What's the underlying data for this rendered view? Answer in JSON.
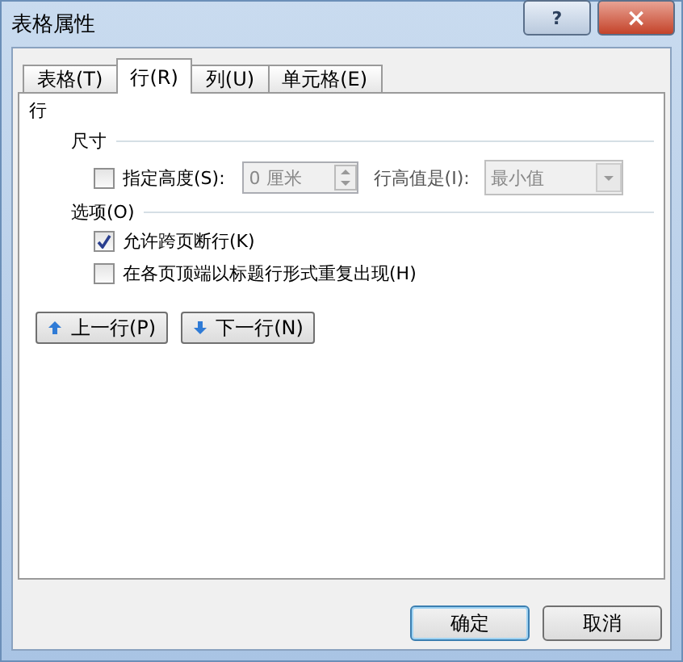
{
  "window": {
    "title": "表格属性",
    "help": "?",
    "close": "×"
  },
  "tabs": [
    {
      "label": "表格(T)",
      "selected": false
    },
    {
      "label": "行(R)",
      "selected": true
    },
    {
      "label": "列(U)",
      "selected": false
    },
    {
      "label": "单元格(E)",
      "selected": false
    }
  ],
  "panel": {
    "heading": "行",
    "size_section": {
      "title": "尺寸",
      "height_checkbox": {
        "label": "指定高度(S):",
        "checked": false
      },
      "height_value": "0 厘米",
      "mode_label": "行高值是(I):",
      "mode_value": "最小值"
    },
    "options_section": {
      "title": "选项(O)",
      "options": [
        {
          "label": "允许跨页断行(K)",
          "checked": true
        },
        {
          "label": "在各页顶端以标题行形式重复出现(H)",
          "checked": false
        }
      ]
    },
    "nav_buttons": [
      {
        "label": "上一行(P)",
        "kind": "up"
      },
      {
        "label": "下一行(N)",
        "kind": "down"
      }
    ]
  },
  "buttons": [
    {
      "label": "确定",
      "default": true
    },
    {
      "label": "取消",
      "default": false
    }
  ]
}
